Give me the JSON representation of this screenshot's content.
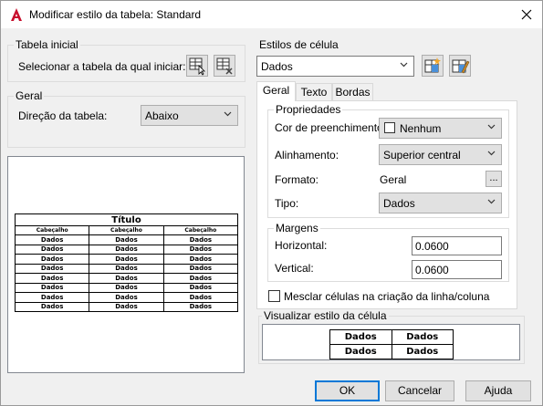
{
  "window": {
    "title": "Modificar estilo da tabela: Standard"
  },
  "starting_table": {
    "group_label": "Tabela inicial",
    "select_label": "Selecionar a tabela da qual iniciar:"
  },
  "general": {
    "group_label": "Geral",
    "direction_label": "Direção da tabela:",
    "direction_value": "Abaixo"
  },
  "preview_table": {
    "title": "Título",
    "header": [
      "Cabeçalho",
      "Cabeçalho",
      "Cabeçalho"
    ],
    "cell": "Dados",
    "data_rows": 8
  },
  "cell_styles": {
    "group_label": "Estilos de célula",
    "style_value": "Dados",
    "tabs": [
      "Geral",
      "Texto",
      "Bordas"
    ],
    "active_tab": "Geral",
    "properties": {
      "group_label": "Propriedades",
      "fill_label": "Cor de preenchimento:",
      "fill_value": "Nenhum",
      "alignment_label": "Alinhamento:",
      "alignment_value": "Superior central",
      "format_label": "Formato:",
      "format_value": "Geral",
      "format_button": "...",
      "type_label": "Tipo:",
      "type_value": "Dados"
    },
    "margins": {
      "group_label": "Margens",
      "horizontal_label": "Horizontal:",
      "horizontal_value": "0.0600",
      "vertical_label": "Vertical:",
      "vertical_value": "0.0600"
    },
    "merge_label": "Mesclar células na criação da linha/coluna",
    "merge_checked": false,
    "preview_label": "Visualizar estilo da célula",
    "preview_cells": [
      [
        "Dados",
        "Dados"
      ],
      [
        "Dados",
        "Dados"
      ]
    ]
  },
  "buttons": {
    "ok": "OK",
    "cancel": "Cancelar",
    "help": "Ajuda"
  }
}
